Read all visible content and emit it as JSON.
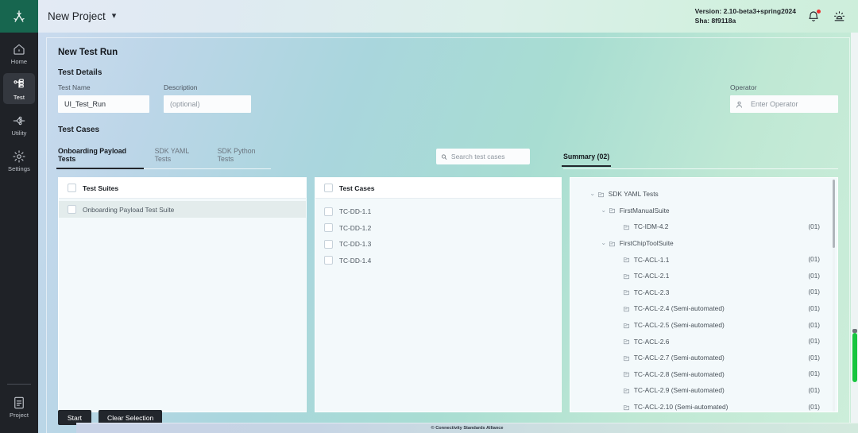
{
  "rail": {
    "logo_icon": "csa-logo-icon",
    "items": [
      {
        "label": "Home",
        "icon": "home-icon",
        "active": false
      },
      {
        "label": "Test",
        "icon": "test-tree-icon",
        "active": true
      },
      {
        "label": "Utility",
        "icon": "utility-node-icon",
        "active": false
      },
      {
        "label": "Settings",
        "icon": "gear-icon",
        "active": false
      }
    ],
    "bottom": {
      "label": "Project",
      "icon": "project-document-icon"
    }
  },
  "topbar": {
    "project_title": "New Project",
    "caret_icon": "chevron-down-icon",
    "version_line1": "Version: 2.10-beta3+spring2024",
    "version_line2": "Sha: 8f9118a",
    "bell_icon": "notification-bell-icon",
    "theme_icon": "brightness-theme-icon"
  },
  "page": {
    "heading": "New Test Run",
    "test_details_label": "Test Details",
    "test_cases_label": "Test Cases"
  },
  "form": {
    "test_name_label": "Test Name",
    "test_name_value": "UI_Test_Run",
    "description_label": "Description",
    "description_placeholder": "(optional)",
    "operator_label": "Operator",
    "operator_placeholder": "Enter Operator",
    "operator_icon": "person-icon"
  },
  "tabs": [
    {
      "label": "Onboarding Payload Tests",
      "active": true
    },
    {
      "label": "SDK YAML Tests",
      "active": false
    },
    {
      "label": "SDK Python Tests",
      "active": false
    }
  ],
  "search": {
    "placeholder": "Search test cases",
    "icon": "search-icon"
  },
  "summary_tab": {
    "label": "Summary (02)"
  },
  "suites_pane": {
    "header": "Test Suites",
    "rows": [
      {
        "label": "Onboarding Payload Test Suite",
        "selected": true
      }
    ]
  },
  "cases_pane": {
    "header": "Test Cases",
    "rows": [
      {
        "label": "TC-DD-1.1"
      },
      {
        "label": "TC-DD-1.2"
      },
      {
        "label": "TC-DD-1.3"
      },
      {
        "label": "TC-DD-1.4"
      }
    ]
  },
  "summary_tree": {
    "nodes": [
      {
        "label": "SDK YAML Tests",
        "level": 0,
        "caret": "⌄",
        "count": "",
        "icon": "folder-icon"
      },
      {
        "label": "FirstManualSuite",
        "level": 1,
        "caret": "⌄",
        "count": "",
        "icon": "folder-icon"
      },
      {
        "label": "TC-IDM-4.2",
        "level": 2,
        "caret": "",
        "count": "(01)",
        "icon": "folder-icon"
      },
      {
        "label": "FirstChipToolSuite",
        "level": 1,
        "caret": "⌄",
        "count": "",
        "icon": "folder-icon"
      },
      {
        "label": "TC-ACL-1.1",
        "level": 2,
        "caret": "",
        "count": "(01)",
        "icon": "folder-icon"
      },
      {
        "label": "TC-ACL-2.1",
        "level": 2,
        "caret": "",
        "count": "(01)",
        "icon": "folder-icon"
      },
      {
        "label": "TC-ACL-2.3",
        "level": 2,
        "caret": "",
        "count": "(01)",
        "icon": "folder-icon"
      },
      {
        "label": "TC-ACL-2.4 (Semi-automated)",
        "level": 2,
        "caret": "",
        "count": "(01)",
        "icon": "folder-icon"
      },
      {
        "label": "TC-ACL-2.5 (Semi-automated)",
        "level": 2,
        "caret": "",
        "count": "(01)",
        "icon": "folder-icon"
      },
      {
        "label": "TC-ACL-2.6",
        "level": 2,
        "caret": "",
        "count": "(01)",
        "icon": "folder-icon"
      },
      {
        "label": "TC-ACL-2.7 (Semi-automated)",
        "level": 2,
        "caret": "",
        "count": "(01)",
        "icon": "folder-icon"
      },
      {
        "label": "TC-ACL-2.8 (Semi-automated)",
        "level": 2,
        "caret": "",
        "count": "(01)",
        "icon": "folder-icon"
      },
      {
        "label": "TC-ACL-2.9 (Semi-automated)",
        "level": 2,
        "caret": "",
        "count": "(01)",
        "icon": "folder-icon"
      },
      {
        "label": "TC-ACL-2.10 (Semi-automated)",
        "level": 2,
        "caret": "",
        "count": "(01)",
        "icon": "folder-icon"
      }
    ]
  },
  "actions": {
    "start_label": "Start",
    "clear_label": "Clear Selection"
  },
  "footer": {
    "copyright": "© Connectivity Standards Alliance"
  },
  "colors": {
    "rail_bg": "#1f2227",
    "logo_bg": "#17664f",
    "button_bg": "#22262c",
    "selected_row": "#e3ecec",
    "pane_bg": "#f3f9fb",
    "scroll_green": "#17c63f",
    "badge_red": "#ef2d2d"
  }
}
